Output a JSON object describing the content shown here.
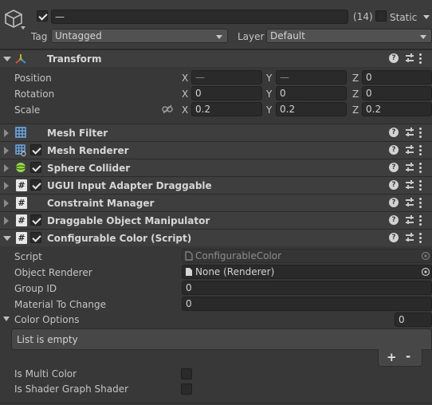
{
  "header": {
    "name_value": "—",
    "count": "(14)",
    "static_label": "Static",
    "tag_label": "Tag",
    "tag_value": "Untagged",
    "layer_label": "Layer",
    "layer_value": "Default"
  },
  "transform": {
    "title": "Transform",
    "rows": [
      {
        "label": "Position",
        "x": "—",
        "y": "—",
        "z": "0"
      },
      {
        "label": "Rotation",
        "x": "0",
        "y": "0",
        "z": "0"
      },
      {
        "label": "Scale",
        "x": "0.2",
        "y": "0.2",
        "z": "0.2"
      }
    ],
    "axes": {
      "x": "X",
      "y": "Y",
      "z": "Z"
    }
  },
  "components": [
    {
      "title": "Mesh Filter",
      "checkbox": false,
      "icon": "grid-icon"
    },
    {
      "title": "Mesh Renderer",
      "checkbox": true,
      "icon": "mesh-renderer-icon"
    },
    {
      "title": "Sphere Collider",
      "checkbox": true,
      "icon": "sphere-icon"
    },
    {
      "title": "UGUI Input Adapter Draggable",
      "checkbox": true,
      "icon": "script-icon"
    },
    {
      "title": "Constraint Manager",
      "checkbox": false,
      "icon": "script-icon"
    },
    {
      "title": "Draggable Object Manipulator",
      "checkbox": true,
      "icon": "script-icon"
    },
    {
      "title": "Configurable Color (Script)",
      "checkbox": true,
      "icon": "script-icon"
    }
  ],
  "script_hash": "#",
  "script_props": {
    "script_label": "Script",
    "script_value": "ConfigurableColor",
    "renderer_label": "Object Renderer",
    "renderer_value": "None (Renderer)",
    "group_label": "Group ID",
    "group_value": "0",
    "material_label": "Material To Change",
    "material_value": "0",
    "color_options_label": "Color Options",
    "color_options_count": "0",
    "list_empty": "List is empty",
    "add": "+",
    "remove": "-",
    "multi_color_label": "Is Multi Color",
    "shader_graph_label": "Is Shader Graph Shader"
  },
  "colors": {
    "background": "#383838",
    "header": "#3e3e3e",
    "field": "#2a2a2a",
    "transform_icon_red": "#e0493c",
    "transform_icon_green": "#7ec13c",
    "transform_icon_blue": "#3f8fe0",
    "sphere_green": "#8fdc3c",
    "mesh_blue": "#6fb7ff"
  }
}
